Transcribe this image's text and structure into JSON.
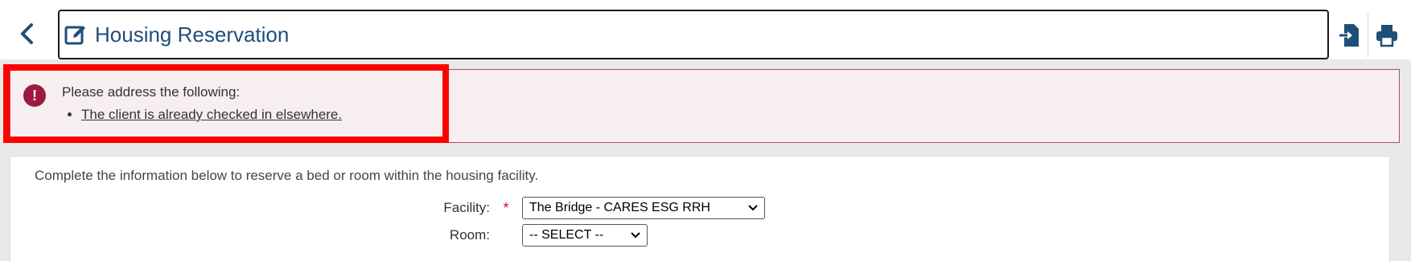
{
  "header": {
    "title": "Housing Reservation",
    "back_icon": "chevron-left-icon",
    "title_icon": "edit-icon",
    "export_icon": "export-icon",
    "print_icon": "print-icon"
  },
  "error": {
    "heading": "Please address the following:",
    "items": [
      "The client is already checked in elsewhere."
    ],
    "icon": "exclamation-circle-icon",
    "color": "#9c1a3d"
  },
  "content": {
    "description": "Complete the information below to reserve a bed or room within the housing facility.",
    "fields": [
      {
        "label": "Facility:",
        "required": "*",
        "value": "The Bridge - CARES ESG RRH"
      },
      {
        "label": "Room:",
        "required": "",
        "value": "-- SELECT --"
      }
    ]
  },
  "colors": {
    "title": "#1f4e79",
    "highlight": "#ff0000",
    "required": "#c8102e"
  }
}
